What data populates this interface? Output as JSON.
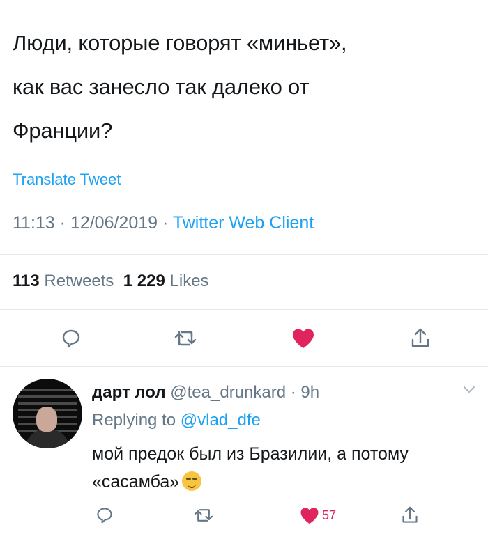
{
  "tweet": {
    "lines": [
      "Люди, которые говорят «миньет»,",
      "как вас занесло так далеко от",
      "Франции?"
    ],
    "translate_label": "Translate Tweet",
    "time": "11:13 · 12/06/2019 · ",
    "client": "Twitter Web Client"
  },
  "stats": {
    "retweets_count": "113",
    "retweets_label": "Retweets",
    "likes_count": "1 229",
    "likes_label": "Likes"
  },
  "reply": {
    "display_name": "дарт лол",
    "handle_time": "@tea_drunkard · 9h",
    "replying_prefix": "Replying to",
    "replying_to": "@vlad_dfe",
    "text": "мой предок был из Бразилии, а потому «сасамба»",
    "like_count": "57"
  },
  "icons": {
    "reply": "reply-icon",
    "retweet": "retweet-icon",
    "like": "heart-icon",
    "share": "share-icon",
    "more": "chevron-down-icon"
  },
  "colors": {
    "accent": "#1da1f2",
    "like": "#e0245e",
    "muted": "#657786",
    "text": "#14171a"
  }
}
